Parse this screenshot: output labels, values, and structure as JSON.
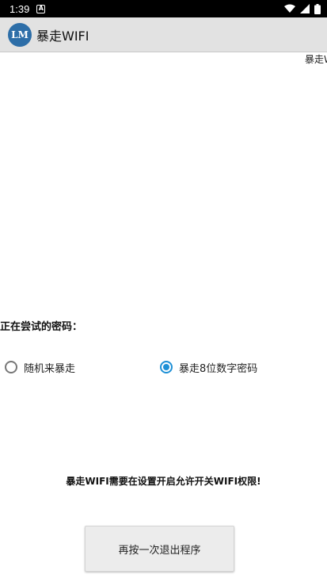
{
  "status_bar": {
    "time": "1:39",
    "notification_icon_letter": "A",
    "icons": [
      "notification-a-icon",
      "wifi-icon",
      "signal-icon",
      "battery-icon"
    ]
  },
  "app_bar": {
    "logo_text": "LM",
    "title": "暴走WIFI",
    "background_color": "#e2e2e2"
  },
  "marquee_text": "暴走W",
  "trying_password_label": "正在尝试的密码：",
  "radio_options": [
    {
      "label": "随机来暴走",
      "checked": false
    },
    {
      "label": "暴走8位数字密码",
      "checked": true
    }
  ],
  "notice_text": "暴走WIFI需要在设置开启允许开关WIFI权限!",
  "exit_button_label": "再按一次退出程序",
  "accent_color": "#1e90d6"
}
